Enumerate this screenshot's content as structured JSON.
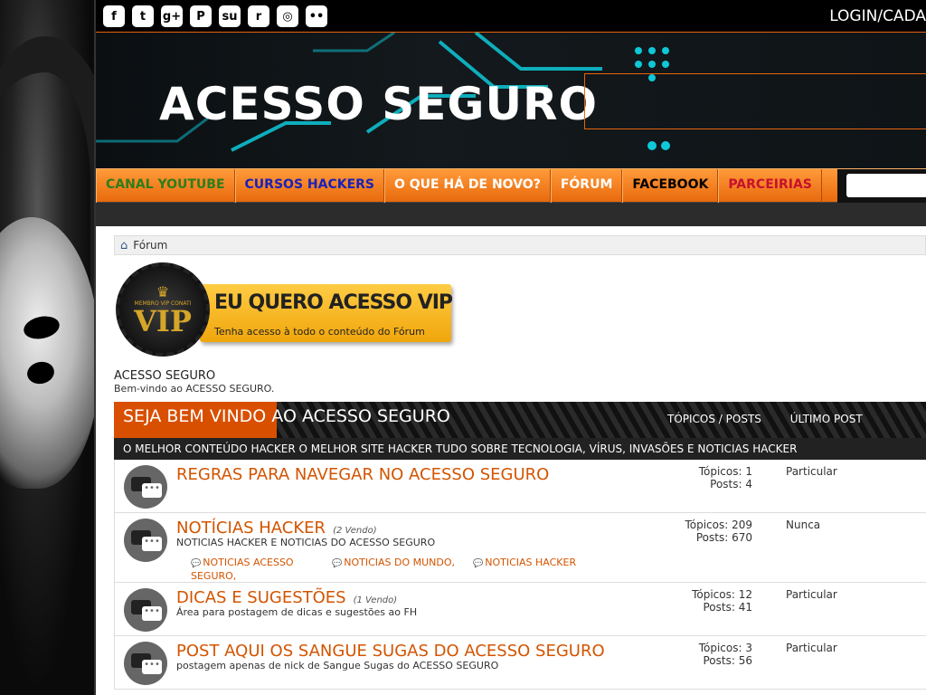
{
  "header": {
    "login_label": "LOGIN/CADA",
    "brand": "ACESSO SEGURO",
    "social_icons": [
      "facebook-icon",
      "twitter-icon",
      "google-plus-icon",
      "pinterest-icon",
      "stumbleupon-icon",
      "reddit-icon",
      "instagram-icon",
      "flickr-icon"
    ],
    "social_glyphs": [
      "f",
      "t",
      "g+",
      "P",
      "su",
      "r",
      "◎",
      "••"
    ]
  },
  "nav": {
    "items": [
      {
        "label": "CANAL YOUTUBE",
        "color": "#2e7d1a"
      },
      {
        "label": "CURSOS HACKERS",
        "color": "#1a22b8"
      },
      {
        "label": "O QUE HÁ DE NOVO?",
        "color": "#ffffff"
      },
      {
        "label": "FÓRUM",
        "color": "#ffffff"
      },
      {
        "label": "FACEBOOK",
        "color": "#000000"
      },
      {
        "label": "PARCEIRIAS",
        "color": "#c8102e"
      }
    ]
  },
  "breadcrumb": {
    "label": "Fórum"
  },
  "vip": {
    "seal_top": "MEMBRO VIP CONATI",
    "seal_text": "VIP",
    "headline": "EU QUERO ACESSO VIP",
    "subtext": "Tenha acesso à todo o conteúdo do Fórum"
  },
  "forum": {
    "title": "ACESSO SEGURO",
    "description": "Bem-vindo ao ACESSO SEGURO."
  },
  "category": {
    "title": "SEJA BEM VINDO AO ACESSO SEGURO",
    "col_topics_posts": "TÓPICOS / POSTS",
    "col_last_post": "ÚLTIMO POST",
    "subtitle": "O MELHOR CONTEÚDO HACKER O MELHOR SITE HACKER TUDO SOBRE TECNOLOGIA, VÍRUS, INVASÕES E NOTICIAS HACKER"
  },
  "forums": [
    {
      "name": "REGRAS PARA NAVEGAR NO ACESSO SEGURO",
      "views": "",
      "desc": "",
      "topics": "Tópicos: 1",
      "posts": "Posts: 4",
      "last": "Particular"
    },
    {
      "name": "NOTÍCIAS HACKER",
      "views": "(2 Vendo)",
      "desc": "NOTICIAS HACKER E NOTICIAS DO ACESSO SEGURO",
      "topics": "Tópicos: 209",
      "posts": "Posts: 670",
      "last": "Nunca",
      "subforums": [
        "NOTICIAS ACESSO SEGURO,",
        "NOTICIAS DO MUNDO,",
        "NOTICIAS HACKER"
      ]
    },
    {
      "name": "DICAS E SUGESTÕES",
      "views": "(1 Vendo)",
      "desc": "Área para postagem de dicas e sugestões ao FH",
      "topics": "Tópicos: 12",
      "posts": "Posts: 41",
      "last": "Particular"
    },
    {
      "name": "POST AQUI OS SANGUE SUGAS DO ACESSO SEGURO",
      "views": "",
      "desc": "postagem apenas de nick de Sangue Sugas do ACESSO SEGURO",
      "topics": "Tópicos: 3",
      "posts": "Posts: 56",
      "last": "Particular"
    }
  ]
}
